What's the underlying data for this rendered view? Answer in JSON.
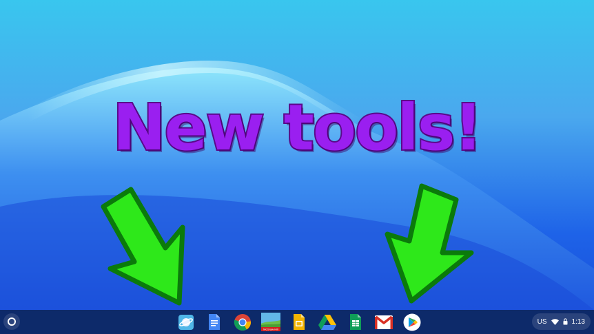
{
  "overlay": {
    "headline": "New tools!",
    "headline_color": "#9a1ff0",
    "arrow_color": "#2ee81a"
  },
  "shelf": {
    "launcher": {
      "icon": "launcher-circle-icon"
    },
    "apps": [
      {
        "name": "Saturn-like app",
        "icon": "planet-app-icon"
      },
      {
        "name": "Google Docs",
        "icon": "docs-icon"
      },
      {
        "name": "Google Chrome",
        "icon": "chrome-icon"
      },
      {
        "name": "McGraw-Hill",
        "icon": "mcgraw-hill-icon",
        "label": "McGraw-Hill"
      },
      {
        "name": "Google Slides",
        "icon": "slides-icon"
      },
      {
        "name": "Google Drive",
        "icon": "drive-icon"
      },
      {
        "name": "Google Sheets",
        "icon": "sheets-icon"
      },
      {
        "name": "Gmail",
        "icon": "gmail-icon"
      },
      {
        "name": "Google Play Store",
        "icon": "play-store-icon"
      }
    ],
    "status": {
      "keyboard_layout": "US",
      "wifi_icon": "wifi-icon",
      "battery_icon": "battery-lock-icon",
      "time": "1:13"
    }
  }
}
